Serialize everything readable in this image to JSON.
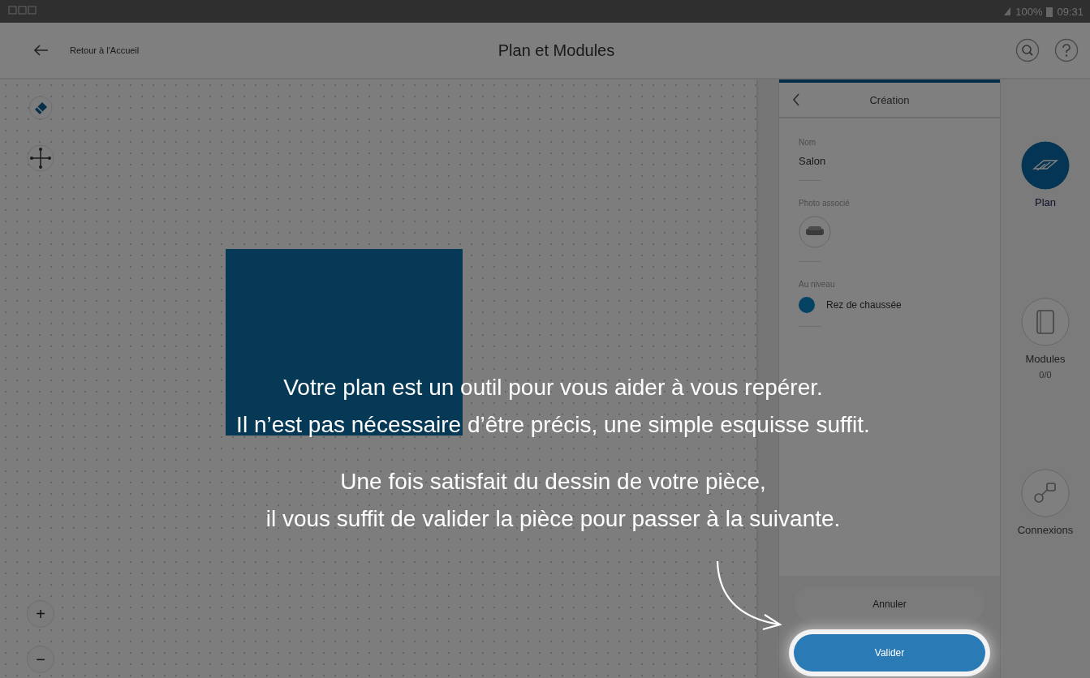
{
  "status_bar": {
    "battery": "100%",
    "time": "09:31"
  },
  "header": {
    "back_label": "Retour à l'Accueil",
    "title": "Plan et Modules"
  },
  "zoom_buttons": [
    "+",
    "−"
  ],
  "panel": {
    "title": "Création",
    "fields": [
      {
        "kind": "text",
        "label": "Nom",
        "value": "Salon"
      },
      {
        "kind": "photo",
        "label": "Photo associé"
      },
      {
        "kind": "radio",
        "label": "Au niveau",
        "option": "Rez de chaussée",
        "checked": true
      }
    ],
    "buttons": [
      {
        "label": "Annuler",
        "primary": false,
        "highlighted": false
      },
      {
        "label": "Valider",
        "primary": true,
        "highlighted": true
      }
    ]
  },
  "rail": [
    {
      "kind": "plan",
      "label": "Plan",
      "selected": true
    },
    {
      "kind": "modules",
      "label": "Modules",
      "count": "0/0",
      "selected": false
    },
    {
      "kind": "connections",
      "label": "Connexions",
      "selected": false
    }
  ],
  "overlay": {
    "paragraphs": [
      [
        "Votre plan est un outil pour vous aider à vous repérer.",
        "Il n’est pas nécessaire d’être précis, une simple esquisse suffit."
      ],
      [
        "Une fois satisfait du dessin de votre pièce,",
        "il vous suffit de valider la pièce pour passer à la suivante."
      ]
    ]
  }
}
